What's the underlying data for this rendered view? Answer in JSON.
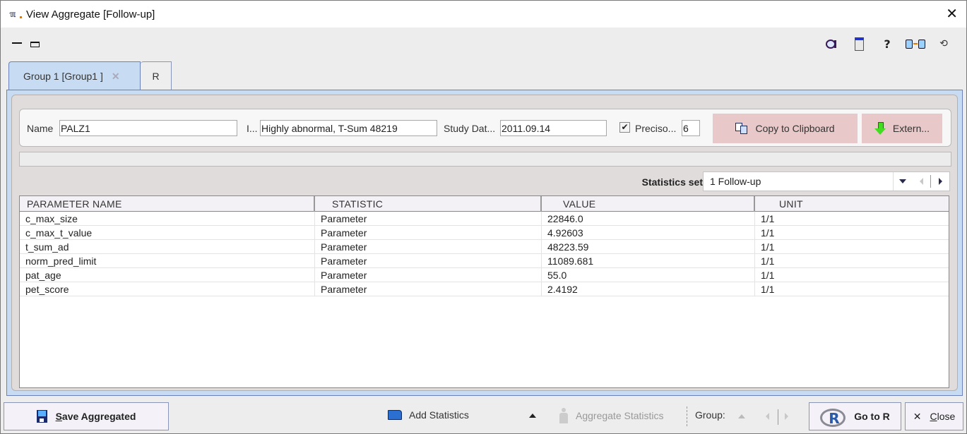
{
  "window": {
    "title": "View Aggregate [Follow-up]",
    "close_glyph": "✕"
  },
  "tabs": [
    {
      "label": "Group 1 [Group1 ]",
      "closable": true,
      "active": true
    },
    {
      "label": "R",
      "closable": false,
      "active": false
    }
  ],
  "tab_close_glyph": "✕",
  "info": {
    "name_label": "Name",
    "name_value": "PALZ1",
    "info_label": "I...",
    "info_value": "Highly abnormal, T-Sum 48219",
    "date_label": "Study Dat...",
    "date_value": "2011.09.14",
    "precision_checked": true,
    "precision_check_glyph": "✔",
    "precision_label": "Preciso...",
    "precision_value": "6",
    "copy_button": "Copy to Clipboard",
    "extern_button": "Extern..."
  },
  "statistics_set": {
    "label": "Statistics set",
    "value": "1 Follow-up"
  },
  "table": {
    "columns": [
      "PARAMETER NAME",
      "STATISTIC",
      "VALUE",
      "UNIT"
    ],
    "rows": [
      [
        "c_max_size",
        "Parameter",
        "22846.0",
        "1/1"
      ],
      [
        "c_max_t_value",
        "Parameter",
        "4.92603",
        "1/1"
      ],
      [
        "t_sum_ad",
        "Parameter",
        "48223.59",
        "1/1"
      ],
      [
        "norm_pred_limit",
        "Parameter",
        "11089.681",
        "1/1"
      ],
      [
        "pat_age",
        "Parameter",
        "55.0",
        "1/1"
      ],
      [
        "pet_score",
        "Parameter",
        "2.4192",
        "1/1"
      ]
    ]
  },
  "bottom": {
    "save_label_mnemonic": "S",
    "save_label_rest": "ave Aggregated",
    "add_statistics": "Add Statistics",
    "aggregate_statistics": "Aggregate Statistics",
    "group_label": "Group:",
    "go_to_r": "Go to R",
    "r_glyph": "R",
    "close_mnemonic": "C",
    "close_rest": "lose",
    "close_glyph": "✕"
  },
  "toolbar_icons": [
    "reference-icon",
    "document-icon",
    "help-icon",
    "database-sync-icon",
    "refresh-icon"
  ],
  "colors": {
    "tab_active": "#c7dcf2",
    "pink_button": "#e8c8c8",
    "panel_bg": "#e0dcdb"
  }
}
